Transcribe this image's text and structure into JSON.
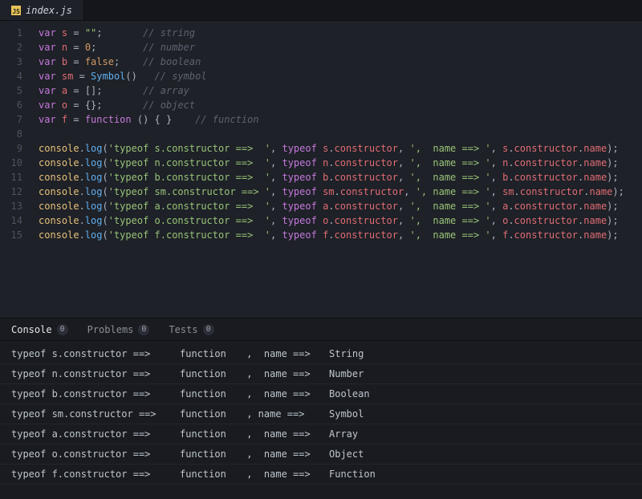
{
  "tab": {
    "filename": "index.js",
    "js_label": "JS"
  },
  "code": {
    "lines": [
      {
        "n": 1,
        "tokens": [
          [
            "kw",
            "var "
          ],
          [
            "var",
            "s"
          ],
          [
            "op",
            " = "
          ],
          [
            "str",
            "\"\""
          ],
          [
            "punc",
            ";"
          ],
          [
            "sp",
            "       "
          ],
          [
            "com",
            "// string"
          ]
        ]
      },
      {
        "n": 2,
        "tokens": [
          [
            "kw",
            "var "
          ],
          [
            "var",
            "n"
          ],
          [
            "op",
            " = "
          ],
          [
            "num",
            "0"
          ],
          [
            "punc",
            ";"
          ],
          [
            "sp",
            "        "
          ],
          [
            "com",
            "// number"
          ]
        ]
      },
      {
        "n": 3,
        "tokens": [
          [
            "kw",
            "var "
          ],
          [
            "var",
            "b"
          ],
          [
            "op",
            " = "
          ],
          [
            "bool",
            "false"
          ],
          [
            "punc",
            ";"
          ],
          [
            "sp",
            "    "
          ],
          [
            "com",
            "// boolean"
          ]
        ]
      },
      {
        "n": 4,
        "tokens": [
          [
            "kw",
            "var "
          ],
          [
            "var",
            "sm"
          ],
          [
            "op",
            " = "
          ],
          [
            "call",
            "Symbol"
          ],
          [
            "punc",
            "()"
          ],
          [
            "sp",
            "   "
          ],
          [
            "com",
            "// symbol"
          ]
        ]
      },
      {
        "n": 5,
        "tokens": [
          [
            "kw",
            "var "
          ],
          [
            "var",
            "a"
          ],
          [
            "op",
            " = "
          ],
          [
            "punc",
            "[];"
          ],
          [
            "sp",
            "       "
          ],
          [
            "com",
            "// array"
          ]
        ]
      },
      {
        "n": 6,
        "tokens": [
          [
            "kw",
            "var "
          ],
          [
            "var",
            "o"
          ],
          [
            "op",
            " = "
          ],
          [
            "punc",
            "{};"
          ],
          [
            "sp",
            "       "
          ],
          [
            "com",
            "// object"
          ]
        ]
      },
      {
        "n": 7,
        "tokens": [
          [
            "kw",
            "var "
          ],
          [
            "var",
            "f"
          ],
          [
            "op",
            " = "
          ],
          [
            "kw",
            "function "
          ],
          [
            "punc",
            "() { }"
          ],
          [
            "sp",
            "    "
          ],
          [
            "com",
            "// function"
          ]
        ]
      },
      {
        "n": 8,
        "tokens": []
      },
      {
        "n": 9,
        "tokens": [
          [
            "obj",
            "console"
          ],
          [
            "punc",
            "."
          ],
          [
            "call",
            "log"
          ],
          [
            "punc",
            "("
          ],
          [
            "str",
            "'typeof s.constructor ==>  '"
          ],
          [
            "punc",
            ", "
          ],
          [
            "kw",
            "typeof "
          ],
          [
            "var",
            "s"
          ],
          [
            "punc",
            "."
          ],
          [
            "prop",
            "constructor"
          ],
          [
            "punc",
            ", "
          ],
          [
            "str",
            "',  name ==> '"
          ],
          [
            "punc",
            ", "
          ],
          [
            "var",
            "s"
          ],
          [
            "punc",
            "."
          ],
          [
            "prop",
            "constructor"
          ],
          [
            "punc",
            "."
          ],
          [
            "var",
            "name"
          ],
          [
            "punc",
            ");"
          ]
        ]
      },
      {
        "n": 10,
        "tokens": [
          [
            "obj",
            "console"
          ],
          [
            "punc",
            "."
          ],
          [
            "call",
            "log"
          ],
          [
            "punc",
            "("
          ],
          [
            "str",
            "'typeof n.constructor ==>  '"
          ],
          [
            "punc",
            ", "
          ],
          [
            "kw",
            "typeof "
          ],
          [
            "var",
            "n"
          ],
          [
            "punc",
            "."
          ],
          [
            "prop",
            "constructor"
          ],
          [
            "punc",
            ", "
          ],
          [
            "str",
            "',  name ==> '"
          ],
          [
            "punc",
            ", "
          ],
          [
            "var",
            "n"
          ],
          [
            "punc",
            "."
          ],
          [
            "prop",
            "constructor"
          ],
          [
            "punc",
            "."
          ],
          [
            "var",
            "name"
          ],
          [
            "punc",
            ");"
          ]
        ]
      },
      {
        "n": 11,
        "tokens": [
          [
            "obj",
            "console"
          ],
          [
            "punc",
            "."
          ],
          [
            "call",
            "log"
          ],
          [
            "punc",
            "("
          ],
          [
            "str",
            "'typeof b.constructor ==>  '"
          ],
          [
            "punc",
            ", "
          ],
          [
            "kw",
            "typeof "
          ],
          [
            "var",
            "b"
          ],
          [
            "punc",
            "."
          ],
          [
            "prop",
            "constructor"
          ],
          [
            "punc",
            ", "
          ],
          [
            "str",
            "',  name ==> '"
          ],
          [
            "punc",
            ", "
          ],
          [
            "var",
            "b"
          ],
          [
            "punc",
            "."
          ],
          [
            "prop",
            "constructor"
          ],
          [
            "punc",
            "."
          ],
          [
            "var",
            "name"
          ],
          [
            "punc",
            ");"
          ]
        ]
      },
      {
        "n": 12,
        "tokens": [
          [
            "obj",
            "console"
          ],
          [
            "punc",
            "."
          ],
          [
            "call",
            "log"
          ],
          [
            "punc",
            "("
          ],
          [
            "str",
            "'typeof sm.constructor ==> '"
          ],
          [
            "punc",
            ", "
          ],
          [
            "kw",
            "typeof "
          ],
          [
            "var",
            "sm"
          ],
          [
            "punc",
            "."
          ],
          [
            "prop",
            "constructor"
          ],
          [
            "punc",
            ", "
          ],
          [
            "str",
            "', name ==> '"
          ],
          [
            "punc",
            ", "
          ],
          [
            "var",
            "sm"
          ],
          [
            "punc",
            "."
          ],
          [
            "prop",
            "constructor"
          ],
          [
            "punc",
            "."
          ],
          [
            "var",
            "name"
          ],
          [
            "punc",
            ");"
          ]
        ]
      },
      {
        "n": 13,
        "tokens": [
          [
            "obj",
            "console"
          ],
          [
            "punc",
            "."
          ],
          [
            "call",
            "log"
          ],
          [
            "punc",
            "("
          ],
          [
            "str",
            "'typeof a.constructor ==>  '"
          ],
          [
            "punc",
            ", "
          ],
          [
            "kw",
            "typeof "
          ],
          [
            "var",
            "a"
          ],
          [
            "punc",
            "."
          ],
          [
            "prop",
            "constructor"
          ],
          [
            "punc",
            ", "
          ],
          [
            "str",
            "',  name ==> '"
          ],
          [
            "punc",
            ", "
          ],
          [
            "var",
            "a"
          ],
          [
            "punc",
            "."
          ],
          [
            "prop",
            "constructor"
          ],
          [
            "punc",
            "."
          ],
          [
            "var",
            "name"
          ],
          [
            "punc",
            ");"
          ]
        ]
      },
      {
        "n": 14,
        "tokens": [
          [
            "obj",
            "console"
          ],
          [
            "punc",
            "."
          ],
          [
            "call",
            "log"
          ],
          [
            "punc",
            "("
          ],
          [
            "str",
            "'typeof o.constructor ==>  '"
          ],
          [
            "punc",
            ", "
          ],
          [
            "kw",
            "typeof "
          ],
          [
            "var",
            "o"
          ],
          [
            "punc",
            "."
          ],
          [
            "prop",
            "constructor"
          ],
          [
            "punc",
            ", "
          ],
          [
            "str",
            "',  name ==> '"
          ],
          [
            "punc",
            ", "
          ],
          [
            "var",
            "o"
          ],
          [
            "punc",
            "."
          ],
          [
            "prop",
            "constructor"
          ],
          [
            "punc",
            "."
          ],
          [
            "var",
            "name"
          ],
          [
            "punc",
            ");"
          ]
        ]
      },
      {
        "n": 15,
        "tokens": [
          [
            "obj",
            "console"
          ],
          [
            "punc",
            "."
          ],
          [
            "call",
            "log"
          ],
          [
            "punc",
            "("
          ],
          [
            "str",
            "'typeof f.constructor ==>  '"
          ],
          [
            "punc",
            ", "
          ],
          [
            "kw",
            "typeof "
          ],
          [
            "var",
            "f"
          ],
          [
            "punc",
            "."
          ],
          [
            "prop",
            "constructor"
          ],
          [
            "punc",
            ", "
          ],
          [
            "str",
            "',  name ==> '"
          ],
          [
            "punc",
            ", "
          ],
          [
            "var",
            "f"
          ],
          [
            "punc",
            "."
          ],
          [
            "prop",
            "constructor"
          ],
          [
            "punc",
            "."
          ],
          [
            "var",
            "name"
          ],
          [
            "punc",
            ");"
          ]
        ]
      }
    ]
  },
  "panel": {
    "tabs": [
      {
        "label": "Console",
        "badge": "0",
        "active": true
      },
      {
        "label": "Problems",
        "badge": "0",
        "active": false
      },
      {
        "label": "Tests",
        "badge": "0",
        "active": false
      }
    ],
    "output": [
      {
        "a": "typeof s.constructor ==>  ",
        "b": "function",
        "c": " ,  name ==>  ",
        "d": "String"
      },
      {
        "a": "typeof n.constructor ==>  ",
        "b": "function",
        "c": " ,  name ==>  ",
        "d": "Number"
      },
      {
        "a": "typeof b.constructor ==>  ",
        "b": "function",
        "c": " ,  name ==>  ",
        "d": "Boolean"
      },
      {
        "a": "typeof sm.constructor ==> ",
        "b": "function",
        "c": " , name ==>  ",
        "d": "Symbol"
      },
      {
        "a": "typeof a.constructor ==>  ",
        "b": "function",
        "c": " ,  name ==>  ",
        "d": "Array"
      },
      {
        "a": "typeof o.constructor ==>  ",
        "b": "function",
        "c": " ,  name ==>  ",
        "d": "Object"
      },
      {
        "a": "typeof f.constructor ==>  ",
        "b": "function",
        "c": " ,  name ==>  ",
        "d": "Function"
      }
    ]
  }
}
